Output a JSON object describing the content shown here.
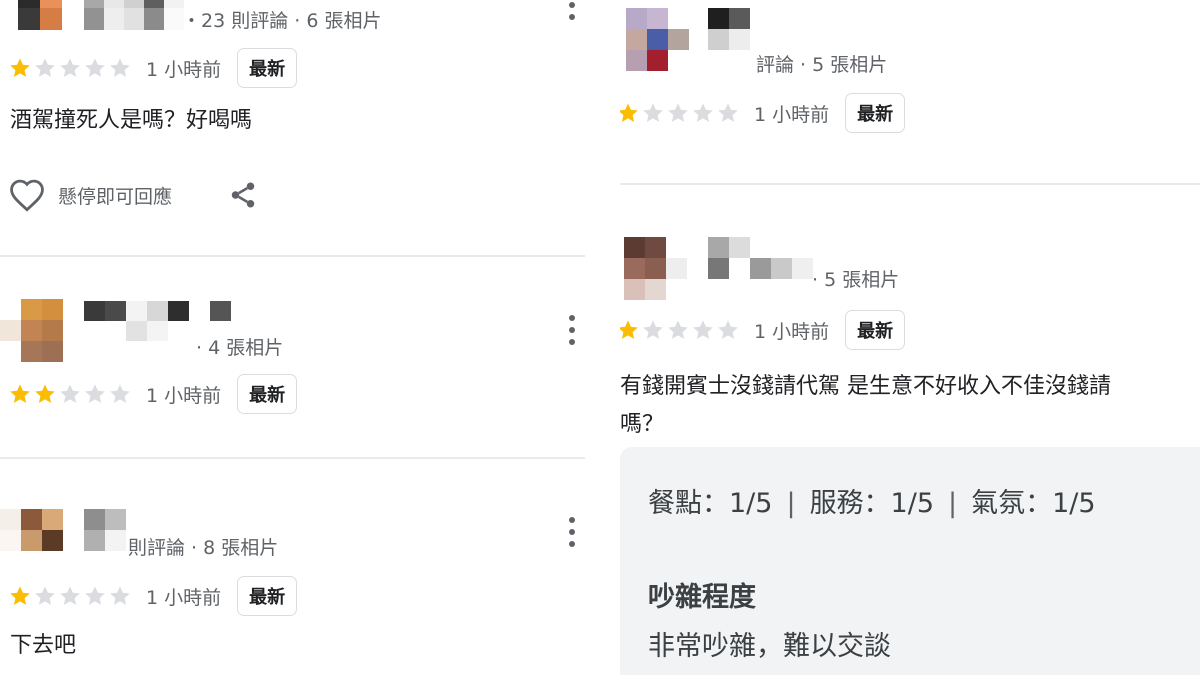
{
  "colors": {
    "star_filled": "#fbbc04",
    "star_empty": "#dadce0",
    "badge_border": "#dadce0",
    "summary_bg": "#f1f3f4"
  },
  "icons": {
    "like": "heart-outline-icon",
    "share": "share-icon",
    "more": "more-vert-icon",
    "star": "star-icon"
  },
  "left_reviews": [
    {
      "stats": "・23 則評論 · 6 張相片",
      "rating": 1,
      "time": "1 小時前",
      "badge": "最新",
      "text": "酒駕撞死人是嗎？好喝嗎",
      "like_label": "懸停即可回應"
    },
    {
      "stats": "‧ 4 張相片",
      "rating": 2,
      "time": "1 小時前",
      "badge": "最新",
      "text": ""
    },
    {
      "stats": "則評論 · 8 張相片",
      "rating": 1,
      "time": "1 小時前",
      "badge": "最新",
      "text": "下去吧"
    }
  ],
  "right_reviews": [
    {
      "stats": "評論 · 5 張相片",
      "rating": 1,
      "time": "1 小時前",
      "badge": "最新"
    },
    {
      "stats": "· 5 張相片",
      "rating": 1,
      "time": "1 小時前",
      "badge": "最新",
      "text_line1": "有錢開賓士沒錢請代駕 是生意不好收入不佳沒錢請",
      "text_line2": "嗎？"
    }
  ],
  "summary": {
    "food": "餐點：1/5",
    "service": "服務：1/5",
    "atmosphere": "氣氛：1/5",
    "separator": "|",
    "noise_title": "吵雜程度",
    "noise_value": "非常吵雜，難以交談"
  }
}
